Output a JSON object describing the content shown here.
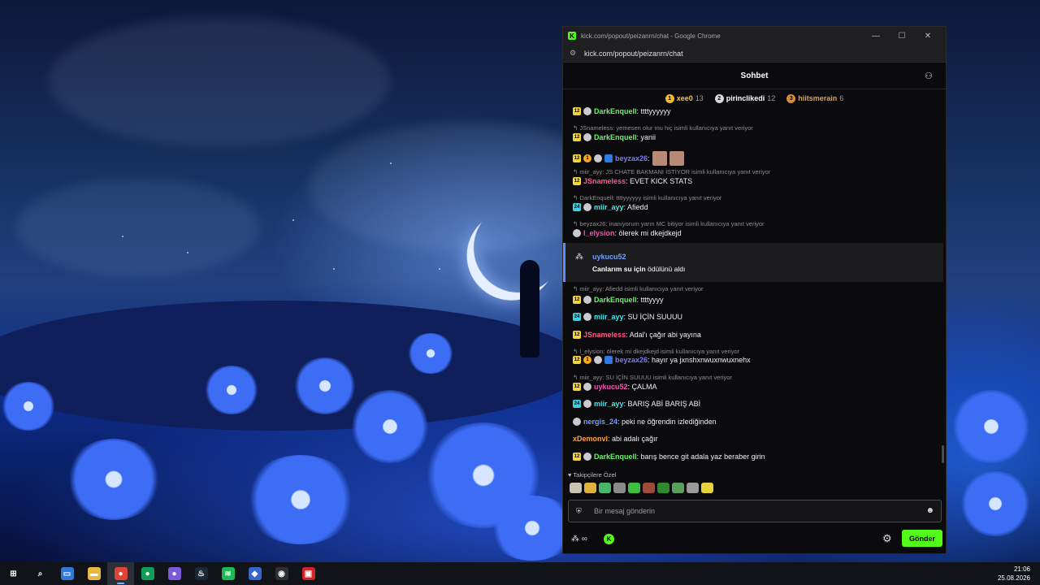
{
  "window": {
    "title": "kick.com/popout/peizanrn/chat - Google Chrome",
    "url": "kick.com/popout/peizanrn/chat",
    "favicon": "kick-icon"
  },
  "chat": {
    "title": "Sohbet",
    "leaderboard": [
      {
        "rank": "1",
        "name": "xee0",
        "count": "13",
        "badge_color": "#f5b82e",
        "name_color": "#f5c542"
      },
      {
        "rank": "2",
        "name": "pirinclikedi",
        "count": "12",
        "badge_color": "#d8d8dc",
        "name_color": "#ffffff"
      },
      {
        "rank": "3",
        "name": "hiitsmerain",
        "count": "6",
        "badge_color": "#d98a3d",
        "name_color": "#e89a4e"
      }
    ],
    "replies": [
      {
        "text": "JSnameless: yemesen olur mu hiç isimli kullanıcıya yanıt veriyor"
      },
      {
        "text": "miir_ayy: JS CHATE BAKMANI İSTİYOR isimli kullanıcıya yanıt veriyor"
      },
      {
        "text": "DarkEnquell: ttttyyyyyy isimli kullanıcıya yanıt veriyor"
      },
      {
        "text": "beyzax26: inanıyorum yarın MC bitiyor isimli kullanıcıya yanıt veriyor"
      },
      {
        "text": "miir_ayy: Afiedd isimli kullanıcıya yanıt veriyor"
      },
      {
        "text": "l_elysion: ölerek mi dkejdkejd isimli kullanıcıya yanıt veriyor"
      },
      {
        "text": "miir_ayy: SU İÇİN SUUUU isimli kullanıcıya yanıt veriyor"
      }
    ],
    "messages": [
      {
        "user": "DarkEnquell",
        "color": "#6ff26f",
        "sep": ":",
        "text": " ttttyyyyyy",
        "badges": [
          "sub",
          "av"
        ]
      },
      {
        "user": "DarkEnquell",
        "color": "#6ff26f",
        "sep": ":",
        "text": " yanii",
        "badges": [
          "sub",
          "av"
        ]
      },
      {
        "user": "beyzax26",
        "color": "#7b7bff",
        "sep": ":",
        "text": "",
        "badges": [
          "sub",
          "coin",
          "av",
          "pix"
        ]
      },
      {
        "user": "JSnameless",
        "color": "#ff5a8a",
        "sep": ":",
        "text": " EVET KICK STATS",
        "badges": [
          "sub"
        ]
      },
      {
        "user": "miir_ayy",
        "color": "#44e8f0",
        "sep": ":",
        "text": " Afiedd",
        "badges": [
          "sub2",
          "av"
        ]
      },
      {
        "user": "l_elysion",
        "color": "#ff4fb8",
        "sep": ":",
        "text": " ölerek mi dkejdkejd",
        "badges": [
          "av"
        ]
      },
      {
        "user": "DarkEnquell",
        "color": "#6ff26f",
        "sep": ":",
        "text": " ttttyyyy",
        "badges": [
          "sub",
          "av"
        ]
      },
      {
        "user": "miir_ayy",
        "color": "#44e8f0",
        "sep": ":",
        "text": " SU İÇİN SUUUU",
        "badges": [
          "sub2",
          "av"
        ]
      },
      {
        "user": "JSnameless",
        "color": "#ff5a8a",
        "sep": ":",
        "text": " Adal'ı çağır abi yayına",
        "badges": [
          "sub"
        ]
      },
      {
        "user": "beyzax26",
        "color": "#7b7bff",
        "sep": ":",
        "text": " hayır ya jxnshxnwuxnwuxnehx",
        "badges": [
          "sub",
          "coin",
          "av",
          "pix"
        ]
      },
      {
        "user": "uykucu52",
        "color": "#ff4fb8",
        "sep": ":",
        "text": " ÇALMA",
        "badges": [
          "sub",
          "av"
        ]
      },
      {
        "user": "miir_ayy",
        "color": "#44e8f0",
        "sep": ":",
        "text": " BARIŞ ABİ BARIŞ ABİ",
        "badges": [
          "sub2",
          "av"
        ]
      },
      {
        "user": "nergis_24",
        "color": "#7b9cff",
        "sep": ":",
        "text": " peki ne öğrendin izlediğinden",
        "badges": [
          "av"
        ]
      },
      {
        "user": "xDemonvl",
        "color": "#ffa43a",
        "sep": ":",
        "text": " abi adalı çağır",
        "badges": []
      },
      {
        "user": "DarkEnquell",
        "color": "#6ff26f",
        "sep": ":",
        "text": " barış bence git adala yaz beraber girin",
        "badges": [
          "sub",
          "av"
        ]
      }
    ],
    "badge_labels": {
      "sub": "12",
      "sub2": "24",
      "coin": "1"
    },
    "reward": {
      "user": "uykucu52",
      "item": "Canlarım su için",
      "suffix": " ödülünü aldı"
    },
    "emote_section_label": "Takipçilere Özel",
    "emotes": [
      "#c9c2b5",
      "#e0b23a",
      "#4bb36b",
      "#8a8a8a",
      "#3fbf3f",
      "#a04a3a",
      "#2f8a2f",
      "#5aa05a",
      "#9a9a9a",
      "#e8d23a"
    ],
    "input_placeholder": "Bir mesaj gönderin",
    "points": "∞",
    "send_label": "Gönder"
  },
  "taskbar": {
    "time": "21:06",
    "date": "25.08.2026",
    "apps": [
      {
        "name": "start-icon",
        "glyph": "⊞",
        "bg": "transparent"
      },
      {
        "name": "search-icon",
        "glyph": "⌕",
        "bg": "transparent"
      },
      {
        "name": "computer-icon",
        "glyph": "▭",
        "bg": "#2f7ad6"
      },
      {
        "name": "folder-icon",
        "glyph": "▬",
        "bg": "#e6b93a"
      },
      {
        "name": "chrome-icon",
        "glyph": "●",
        "bg": "#db4437"
      },
      {
        "name": "chrome-profile-icon",
        "glyph": "●",
        "bg": "#0f9d58"
      },
      {
        "name": "chrome-alt-icon",
        "glyph": "●",
        "bg": "#7b5cd6"
      },
      {
        "name": "steam-icon",
        "glyph": "♨",
        "bg": "#1b2838"
      },
      {
        "name": "spotify-icon",
        "glyph": "≋",
        "bg": "#1db954"
      },
      {
        "name": "app-diamond-icon",
        "glyph": "◆",
        "bg": "#3566c8"
      },
      {
        "name": "obs-icon",
        "glyph": "◉",
        "bg": "#302e31"
      },
      {
        "name": "app-red-icon",
        "glyph": "▣",
        "bg": "#d3222a"
      }
    ]
  }
}
